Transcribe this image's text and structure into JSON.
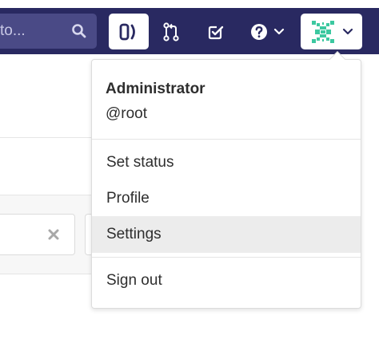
{
  "search": {
    "text": "to..."
  },
  "nav": {
    "todo_panel_icon": "todo-panel-icon",
    "merge_requests_icon": "merge-request-icon",
    "todos_icon": "todos-check-icon",
    "help_icon": "help-icon",
    "avatar_icon": "avatar-identicon"
  },
  "user_menu": {
    "name": "Administrator",
    "handle": "@root",
    "items": [
      {
        "label": "Set status"
      },
      {
        "label": "Profile"
      },
      {
        "label": "Settings"
      },
      {
        "label": "Sign out"
      }
    ]
  },
  "colors": {
    "navbar": "#292961",
    "search_bg": "#4a4a86",
    "avatar": "#3cc8a0",
    "active_item": "#ececec"
  }
}
